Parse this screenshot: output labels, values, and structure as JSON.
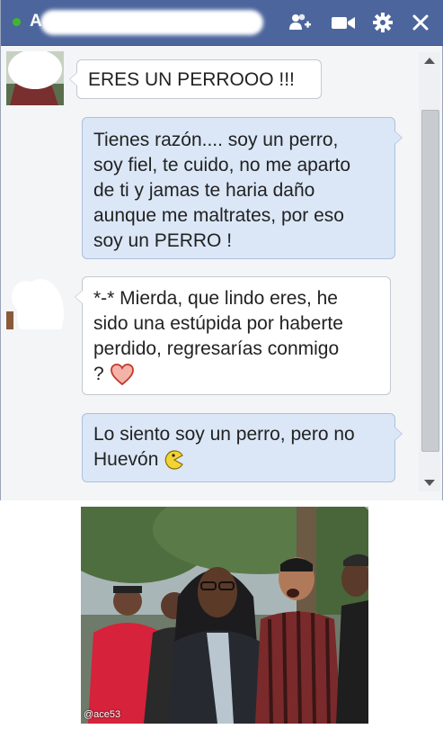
{
  "chat": {
    "title_initial": "A",
    "colors": {
      "header": "#4c669d",
      "online": "#43b42f",
      "outgoing_bubble": "#dbe7f7",
      "incoming_bubble": "#ffffff"
    },
    "header_icons": [
      "add-friend-icon",
      "video-call-icon",
      "gear-icon",
      "close-icon"
    ],
    "messages": [
      {
        "direction": "incoming",
        "text": "ERES UN PERROOO !!!"
      },
      {
        "direction": "outgoing",
        "lines": [
          "Tienes razón.... soy un perro,",
          "soy fiel, te cuido, no me aparto",
          "de ti y jamas te haria daño",
          "aunque me maltrates, por eso",
          "soy un PERRO !"
        ]
      },
      {
        "direction": "incoming",
        "lines": [
          "*-* Mierda, que lindo eres, he",
          "sido una estúpida por haberte",
          "perdido, regresarías conmigo",
          "?"
        ],
        "emoji": "heart-emoji"
      },
      {
        "direction": "outgoing",
        "lines": [
          "Lo siento soy un perro, pero no",
          "Huevón"
        ],
        "emoji": "pacman-emoji"
      }
    ]
  },
  "reaction_image": {
    "watermark": "@ace53"
  }
}
